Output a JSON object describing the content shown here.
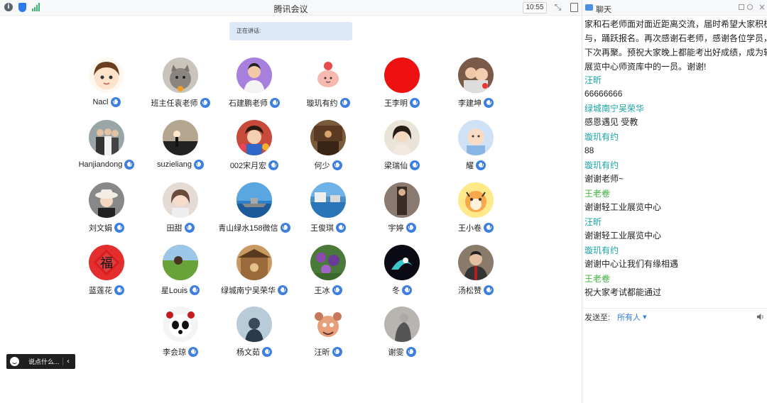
{
  "app": {
    "title": "腾讯会议",
    "time": "10:55"
  },
  "speaking": {
    "label": "正在讲话:"
  },
  "colors": {
    "accent": "#2f7be5",
    "sender": "#1aa2a2",
    "mic": "#3e7fe0"
  },
  "participants": [
    {
      "name": "Nacl",
      "avatar": "cartoon-girl"
    },
    {
      "name": "班主任袁老师",
      "avatar": "cat-photo"
    },
    {
      "name": "石建鹏老师",
      "avatar": "man-purple"
    },
    {
      "name": "璇玑有约",
      "avatar": "cartoon-peach"
    },
    {
      "name": "王李明",
      "avatar": "red-circle"
    },
    {
      "name": "李建坤",
      "avatar": "family-photo"
    },
    {
      "name": "Hanjiandong",
      "avatar": "group-photo"
    },
    {
      "name": "suzieliang",
      "avatar": "sunset-photo"
    },
    {
      "name": "002宋月宏",
      "avatar": "woman-flowers"
    },
    {
      "name": "何少",
      "avatar": "room-photo"
    },
    {
      "name": "梁瑞仙",
      "avatar": "woman-portrait"
    },
    {
      "name": "耀",
      "avatar": "baby-photo"
    },
    {
      "name": "刘文娟",
      "avatar": "woman-hat"
    },
    {
      "name": "田甜",
      "avatar": "woman-light"
    },
    {
      "name": "青山绿水158微信",
      "avatar": "ship-photo"
    },
    {
      "name": "王俊琪",
      "avatar": "sea-building"
    },
    {
      "name": "宇婷",
      "avatar": "dark-figure"
    },
    {
      "name": "王小卷",
      "avatar": "cartoon-tiger"
    },
    {
      "name": "蓝莲花",
      "avatar": "fu-character"
    },
    {
      "name": "星Louis",
      "avatar": "grass-field"
    },
    {
      "name": "绿城南宁吴荣华",
      "avatar": "temple-photo"
    },
    {
      "name": "王冰",
      "avatar": "purple-flowers"
    },
    {
      "name": "冬",
      "avatar": "abstract-dark"
    },
    {
      "name": "汤松赞",
      "avatar": "man-suit"
    },
    {
      "name": "李会琼",
      "avatar": "panda-opera"
    },
    {
      "name": "杨文茹",
      "avatar": "silhouette-sky"
    },
    {
      "name": "汪昕",
      "avatar": "cartoon-monster"
    },
    {
      "name": "谢雯",
      "avatar": "grey-figure"
    }
  ],
  "say_bar": {
    "label": "说点什么..."
  },
  "chat": {
    "title": "聊天",
    "lines": [
      "家和石老师面对面近距离交流，届时希望大家积极参",
      "与，踊跃报名。再次感谢石老师，感谢各位学员，我们",
      "下次再聚。预祝大家晚上都能考出好成绩，成为轻工业",
      "展览中心师资库中的一员。谢谢!"
    ],
    "messages": [
      {
        "sender": "汪昕",
        "text": "66666666"
      },
      {
        "sender": "绿城南宁吴荣华",
        "text": "感恩遇见 受教"
      },
      {
        "sender": "璇玑有约",
        "text": "88"
      },
      {
        "sender": "璇玑有约",
        "text": "谢谢老师~"
      },
      {
        "sender": "王老卷",
        "text": "谢谢轻工业展览中心"
      },
      {
        "sender": "汪昕",
        "text": "谢谢轻工业展览中心"
      },
      {
        "sender": "璇玑有约",
        "text": "谢谢中心让我们有缘相遇"
      },
      {
        "sender": "王老卷",
        "text": "祝大家考试都能通过"
      }
    ],
    "send_label": "发送至:",
    "send_target": "所有人"
  }
}
